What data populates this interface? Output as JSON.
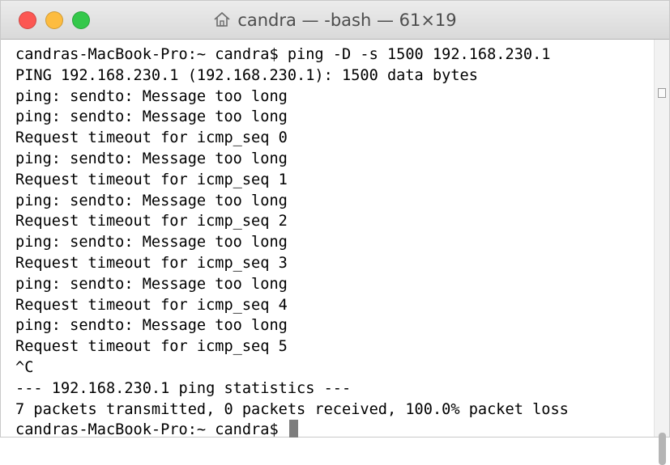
{
  "window": {
    "title": "candra — -bash — 61×19",
    "title_icon": "home-icon",
    "traffic_lights": {
      "close_color": "#fc5753",
      "minimize_color": "#fdbc40",
      "zoom_color": "#34c84a"
    }
  },
  "terminal": {
    "lines": [
      "candras-MacBook-Pro:~ candra$ ping -D -s 1500 192.168.230.1",
      "PING 192.168.230.1 (192.168.230.1): 1500 data bytes",
      "ping: sendto: Message too long",
      "ping: sendto: Message too long",
      "Request timeout for icmp_seq 0",
      "ping: sendto: Message too long",
      "Request timeout for icmp_seq 1",
      "ping: sendto: Message too long",
      "Request timeout for icmp_seq 2",
      "ping: sendto: Message too long",
      "Request timeout for icmp_seq 3",
      "ping: sendto: Message too long",
      "Request timeout for icmp_seq 4",
      "ping: sendto: Message too long",
      "Request timeout for icmp_seq 5",
      "^C",
      "--- 192.168.230.1 ping statistics ---",
      "7 packets transmitted, 0 packets received, 100.0% packet loss"
    ],
    "prompt": "candras-MacBook-Pro:~ candra$ "
  }
}
